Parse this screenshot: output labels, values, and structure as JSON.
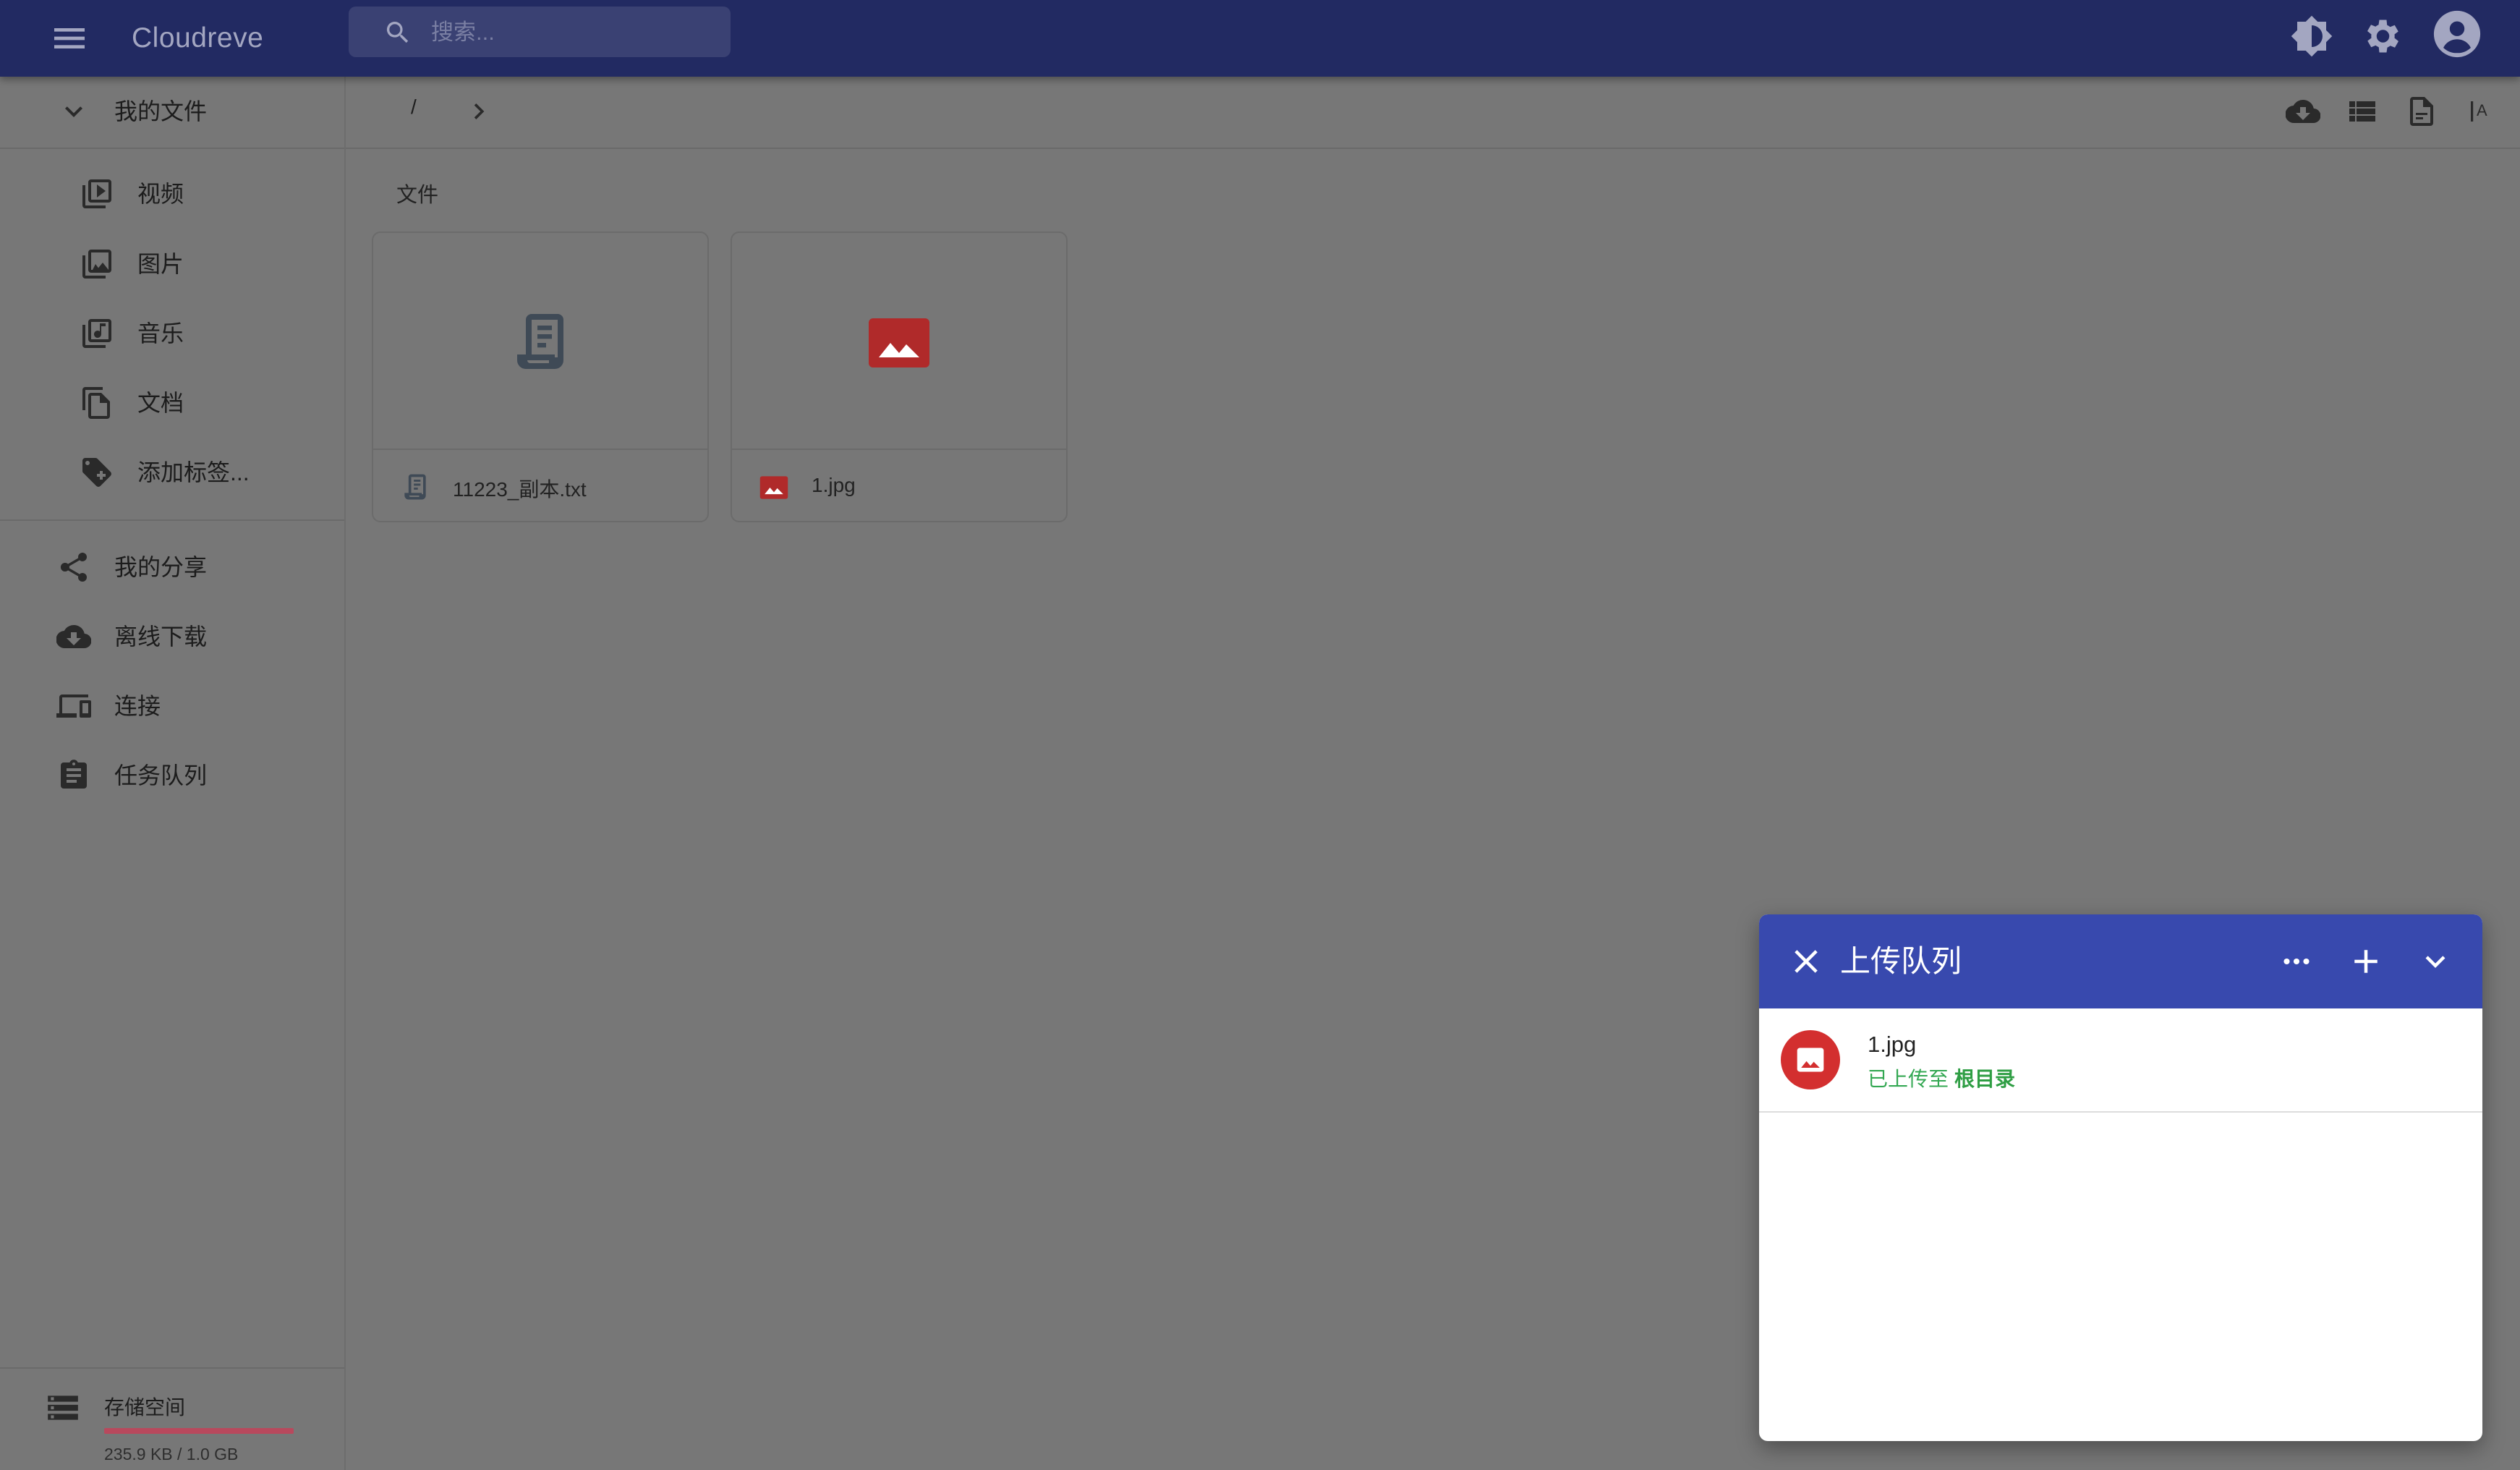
{
  "app": {
    "title": "Cloudreve"
  },
  "search": {
    "placeholder": "搜索..."
  },
  "sidebar": {
    "my_files": "我的文件",
    "categories": [
      {
        "label": "视频",
        "icon": "video-library-icon"
      },
      {
        "label": "图片",
        "icon": "photo-library-icon"
      },
      {
        "label": "音乐",
        "icon": "library-music-icon"
      },
      {
        "label": "文档",
        "icon": "file-copy-icon"
      },
      {
        "label": "添加标签...",
        "icon": "add-tag-icon"
      }
    ],
    "nav": [
      {
        "label": "我的分享",
        "icon": "share-icon"
      },
      {
        "label": "离线下载",
        "icon": "cloud-download-icon"
      },
      {
        "label": "连接",
        "icon": "devices-icon"
      },
      {
        "label": "任务队列",
        "icon": "assignment-icon"
      }
    ],
    "storage": {
      "label": "存储空间",
      "used": "235.9 KB / 1.0 GB",
      "used_fraction": 0.0002
    }
  },
  "breadcrumb": {
    "root": "/"
  },
  "files": {
    "section_title": "文件",
    "items": [
      {
        "name": "11223_副本.txt",
        "type": "text",
        "icon": "text-file-icon"
      },
      {
        "name": "1.jpg",
        "type": "image",
        "icon": "image-file-icon"
      }
    ]
  },
  "upload_queue": {
    "title": "上传队列",
    "items": [
      {
        "filename": "1.jpg",
        "status": "已上传至",
        "destination": "根目录"
      }
    ]
  },
  "colors": {
    "appbar": "#222a62",
    "upload_header": "#3849ae",
    "image_red": "#d32f2f",
    "success_green": "#34a853"
  }
}
